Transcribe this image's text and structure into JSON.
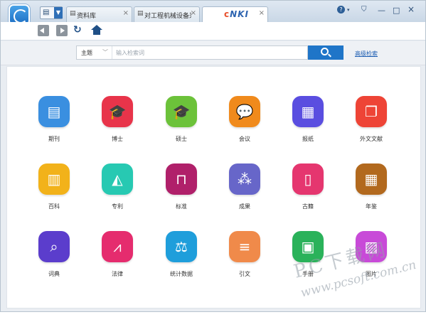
{
  "window": {
    "tabs": [
      {
        "icon": "doc-icon",
        "label": "资料库",
        "close": "×"
      },
      {
        "icon": "doc-icon",
        "label": "对工程机械设备采...",
        "close": "×"
      },
      {
        "icon": "cnki-logo",
        "label": "",
        "close": "×"
      }
    ],
    "cnki_logo_text": "CNKI",
    "controls": {
      "help": "?",
      "shirt": "👕",
      "minimize": "—",
      "maximize": "□",
      "close": "×"
    }
  },
  "search": {
    "field": "主题",
    "placeholder": "输入检索词",
    "value": "",
    "advanced_link": "高级检索"
  },
  "categories": [
    {
      "label": "期刊",
      "icon": "journal-icon",
      "color": "#3a8fe0"
    },
    {
      "label": "博士",
      "icon": "doctor-cap-icon",
      "color": "#e8344a"
    },
    {
      "label": "硕士",
      "icon": "master-cap-icon",
      "color": "#6cc23a"
    },
    {
      "label": "会议",
      "icon": "meeting-chat-icon",
      "color": "#f08a1c"
    },
    {
      "label": "报纸",
      "icon": "newspaper-icon",
      "color": "#5a4ee0"
    },
    {
      "label": "外文文献",
      "icon": "foreign-doc-icon",
      "color": "#ee4436"
    },
    {
      "label": "百科",
      "icon": "encyclopedia-books-icon",
      "color": "#f2b21a"
    },
    {
      "label": "专利",
      "icon": "patent-icon",
      "color": "#27c9b2"
    },
    {
      "label": "标准",
      "icon": "standard-ruler-icon",
      "color": "#b0206a"
    },
    {
      "label": "成果",
      "icon": "achievement-grapes-icon",
      "color": "#6766c9"
    },
    {
      "label": "古籍",
      "icon": "ancient-book-icon",
      "color": "#e5366f"
    },
    {
      "label": "年鉴",
      "icon": "yearbook-calendar-icon",
      "color": "#b2691e"
    },
    {
      "label": "词典",
      "icon": "dictionary-search-icon",
      "color": "#5b3dcc"
    },
    {
      "label": "法律",
      "icon": "law-chart-icon",
      "color": "#e52c6e"
    },
    {
      "label": "统计数据",
      "icon": "statistics-scale-icon",
      "color": "#1f9edb"
    },
    {
      "label": "引文",
      "icon": "citation-scroll-icon",
      "color": "#f08a4a"
    },
    {
      "label": "手册",
      "icon": "handbook-contact-icon",
      "color": "#2ab25a"
    },
    {
      "label": "图片",
      "icon": "picture-icon",
      "color": "#c84ad8"
    }
  ],
  "watermark": {
    "line1": "PC下载网",
    "line2": "www.pcsoft.com.cn"
  }
}
